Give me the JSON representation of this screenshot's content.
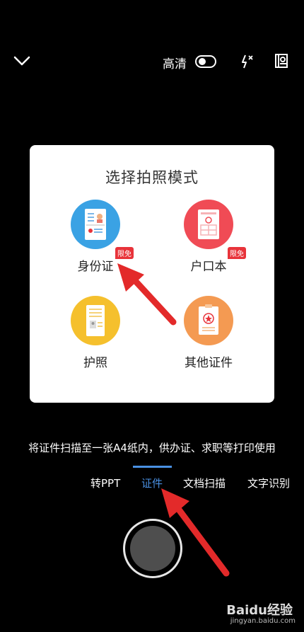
{
  "top_bar": {
    "hd_label": "高清",
    "hd_toggle_on": false
  },
  "modal": {
    "title": "选择拍照模式",
    "options": [
      {
        "label": "身份证",
        "badge": "限免",
        "icon": "id-card-icon",
        "color": "#3aa2e4"
      },
      {
        "label": "户口本",
        "badge": "限免",
        "icon": "household-register-icon",
        "color": "#f04b55"
      },
      {
        "label": "护照",
        "badge": "",
        "icon": "passport-icon",
        "color": "#f5c02d"
      },
      {
        "label": "其他证件",
        "badge": "",
        "icon": "other-certificate-icon",
        "color": "#f49a52"
      }
    ]
  },
  "hint_text": "将证件扫描至一张A4纸内，供办证、求职等打印使用",
  "mode_tabs": [
    {
      "label": "转PPT",
      "active": false
    },
    {
      "label": "证件",
      "active": true
    },
    {
      "label": "文档扫描",
      "active": false
    },
    {
      "label": "文字识别",
      "active": false
    }
  ],
  "accent_color": "#4a90e2",
  "watermark": {
    "brand": "Baidu经验",
    "url": "jingyan.baidu.com"
  }
}
